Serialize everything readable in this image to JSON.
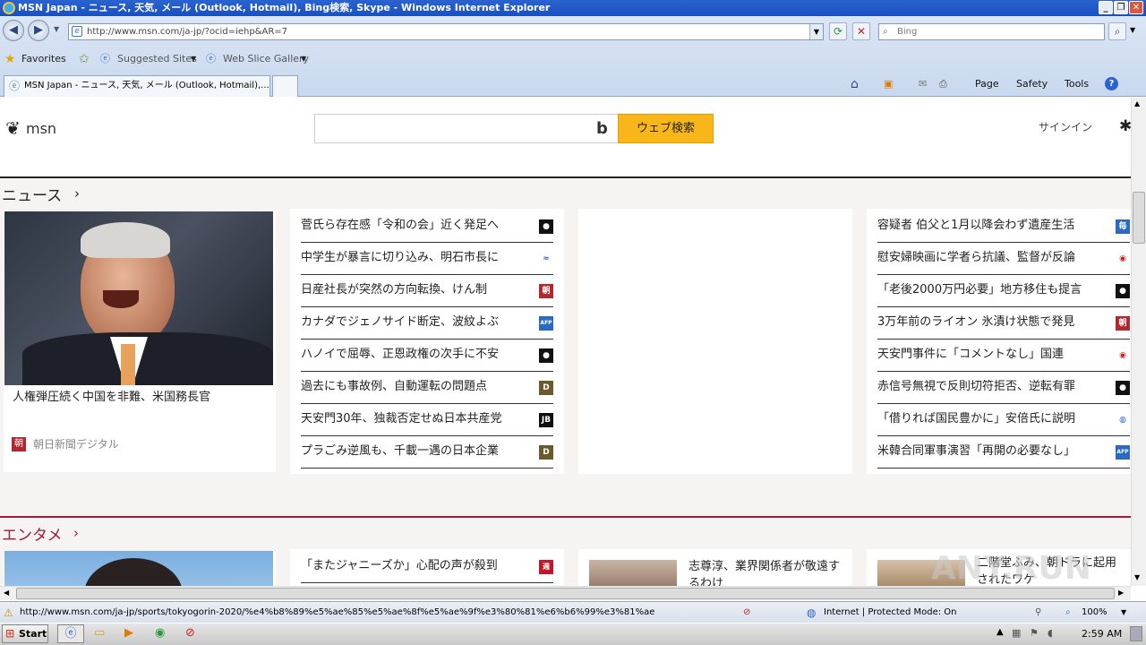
{
  "window": {
    "title": "MSN Japan - ニュース, 天気, メール (Outlook, Hotmail), Bing検索, Skype - Windows Internet Explorer"
  },
  "toolbar": {
    "address": "http://www.msn.com/ja-jp/?ocid=iehp&AR=7",
    "search_placeholder": "Bing",
    "favorites_label": "Favorites",
    "suggested_sites": "Suggested Sites",
    "web_slice": "Web Slice Gallery",
    "tab_title": "MSN Japan - ニュース, 天気, メール (Outlook, Hotmail),...",
    "page_menu": "Page",
    "safety_menu": "Safety",
    "tools_menu": "Tools"
  },
  "msn": {
    "logo_text": "msn",
    "search_button": "ウェブ検索",
    "signin": "サインイン",
    "news_heading": "ニュース",
    "ent_heading": "エンタメ",
    "feature": {
      "caption": "人権弾圧続く中国を非難、米国務長官",
      "source": "朝日新聞デジタル",
      "source_icon": "朝"
    },
    "news_col1": [
      {
        "text": "菅氏ら存在感「令和の会」近く発足へ",
        "icon": "tbs"
      },
      {
        "text": "中学生が暴言に切り込み、明石市長に",
        "icon": "kobe"
      },
      {
        "text": "日産社長が突然の方向転換、けん制",
        "icon": "朝"
      },
      {
        "text": "カナダでジェノサイド断定、波紋よぶ",
        "icon": "AFP"
      },
      {
        "text": "ハノイで屈辱、正恩政権の次手に不安",
        "icon": "tbs"
      },
      {
        "text": "過去にも事故例、自動運転の問題点",
        "icon": "D"
      },
      {
        "text": "天安門30年、独裁否定せぬ日本共産党",
        "icon": "JB"
      },
      {
        "text": "プラごみ逆風も、千載一遇の日本企業",
        "icon": "D"
      }
    ],
    "news_col3": [
      {
        "text": "容疑者 伯父と1月以降会わず遺産生活",
        "icon": "毎"
      },
      {
        "text": "慰安婦映画に学者ら抗議、監督が反論",
        "icon": "eye"
      },
      {
        "text": "「老後2000万円必要」地方移住も提言",
        "icon": "tbs"
      },
      {
        "text": "3万年前のライオン 氷漬け状態で発見",
        "icon": "朝"
      },
      {
        "text": "天安門事件に「コメントなし」国連",
        "icon": "eye"
      },
      {
        "text": "赤信号無視で反則切符拒否、逆転有罪",
        "icon": "tbs"
      },
      {
        "text": "「借りれば国民豊かに」安倍氏に説明",
        "icon": "globe"
      },
      {
        "text": "米韓合同軍事演習「再開の必要なし」",
        "icon": "AFP"
      }
    ],
    "ent": {
      "col1": "「またジャニーズか」心配の声が殺到",
      "col1_icon": "週",
      "col2": "志尊淳、業界関係者が敬遠するわけ",
      "col3": "二階堂ふみ、朝ドラに起用されたワケ"
    }
  },
  "status": {
    "url": "http://www.msn.com/ja-jp/sports/tokyogorin-2020/%e4%b8%89%e5%ae%85%e5%ae%8f%e5%ae%9f%e3%80%81%e6%b6%99%e3%81%ae",
    "zone": "Internet | Protected Mode: On",
    "zoom": "100%"
  },
  "taskbar": {
    "start": "Start",
    "clock": "2:59 AM"
  },
  "watermark": "ANY.RUN"
}
